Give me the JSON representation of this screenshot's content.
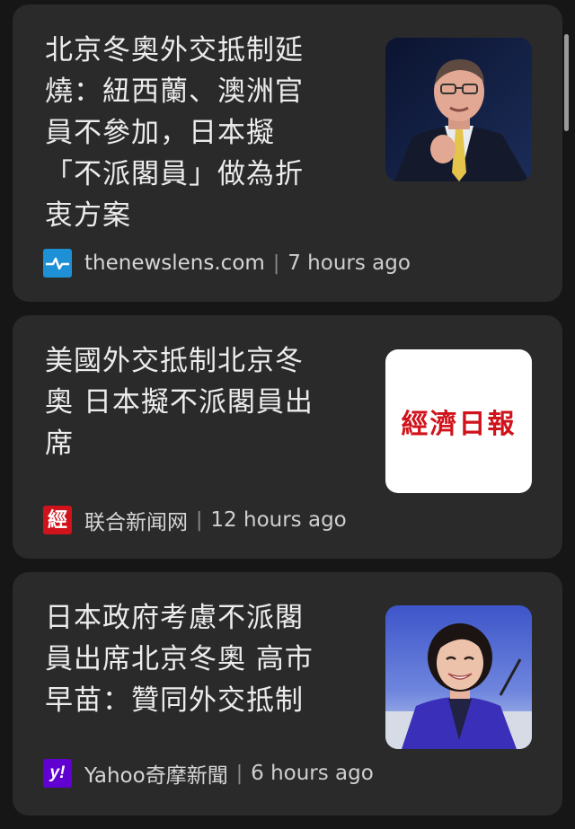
{
  "articles": [
    {
      "headline_lines": [
        "北京冬奧外交抵制延",
        "燒：紐西蘭、澳洲官",
        "員不參加，日本擬",
        "「不派閣員」做為折",
        "衷方案"
      ],
      "source": "thenewslens.com",
      "separator": "|",
      "time": "7 hours ago",
      "favicon_icon": "newslens-pulse-icon",
      "thumbnail_icon": "politician-speaking-photo"
    },
    {
      "headline_lines": [
        "美國外交抵制北京冬",
        "奧 日本擬不派閣員出",
        "席"
      ],
      "source": "联合新闻网",
      "separator": "|",
      "time": "12 hours ago",
      "favicon_icon": "udn-logo-icon",
      "favicon_text": "經",
      "thumbnail_icon": "newspaper-masthead-logo",
      "thumbnail_text": "經濟日報"
    },
    {
      "headline_lines": [
        "日本政府考慮不派閣",
        "員出席北京冬奧 高市",
        "早苗：贊同外交抵制"
      ],
      "source": "Yahoo奇摩新聞",
      "separator": "|",
      "time": "6 hours ago",
      "favicon_icon": "yahoo-logo-icon",
      "favicon_text": "y!",
      "thumbnail_icon": "woman-smiling-photo"
    }
  ],
  "colors": {
    "background": "#161616",
    "card": "#2a2a2b",
    "headline": "#ececec",
    "meta": "#d6d6d6",
    "newslens_blue": "#1e90d6",
    "udn_red": "#d0121b",
    "yahoo_purple": "#6001d2"
  }
}
